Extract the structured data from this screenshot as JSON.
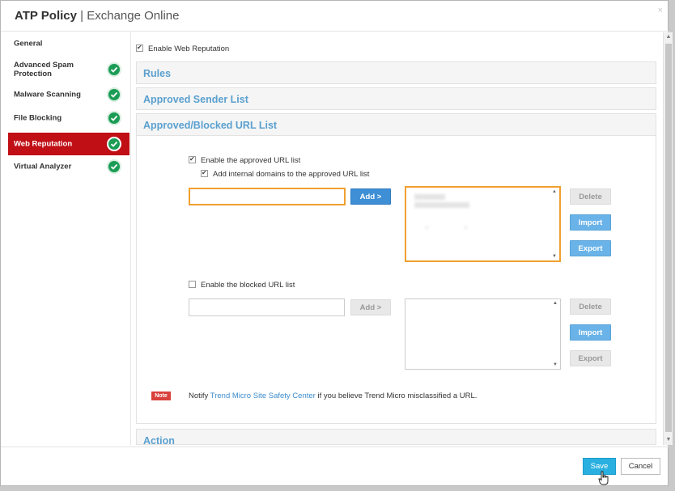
{
  "dialog": {
    "title": "ATP Policy",
    "separator": " | ",
    "subtitle": "Exchange Online",
    "close": "×"
  },
  "sidebar": {
    "items": [
      {
        "label": "General",
        "checked": false,
        "active": false
      },
      {
        "label": "Advanced Spam Protection",
        "checked": true,
        "active": false
      },
      {
        "label": "Malware Scanning",
        "checked": true,
        "active": false
      },
      {
        "label": "File Blocking",
        "checked": true,
        "active": false
      },
      {
        "label": "Web Reputation",
        "checked": true,
        "active": true
      },
      {
        "label": "Virtual Analyzer",
        "checked": true,
        "active": false
      }
    ]
  },
  "main": {
    "enable_web_reputation": "Enable Web Reputation",
    "sections": {
      "rules": "Rules",
      "approved_sender": "Approved Sender List",
      "url_list": "Approved/Blocked URL List",
      "action": "Action"
    },
    "approved": {
      "enable_label": "Enable the approved URL list",
      "internal_label": "Add internal domains to the approved URL list",
      "input_value": "",
      "add_label": "Add >",
      "delete_label": "Delete",
      "import_label": "Import",
      "export_label": "Export"
    },
    "blocked": {
      "enable_label": "Enable the blocked URL list",
      "input_value": "",
      "add_label": "Add >",
      "delete_label": "Delete",
      "import_label": "Import",
      "export_label": "Export"
    },
    "note": {
      "badge": "Note",
      "prefix": "Notify ",
      "link": "Trend Micro Site Safety Center",
      "suffix": " if you believe Trend Micro misclassified a URL."
    }
  },
  "footer": {
    "save_label": "Save",
    "cancel_label": "Cancel"
  },
  "colors": {
    "accent": "#c10f16",
    "link": "#5aa0cf",
    "check": "#1b9c55",
    "focus": "#f0a030",
    "save": "#2ab0e0"
  }
}
